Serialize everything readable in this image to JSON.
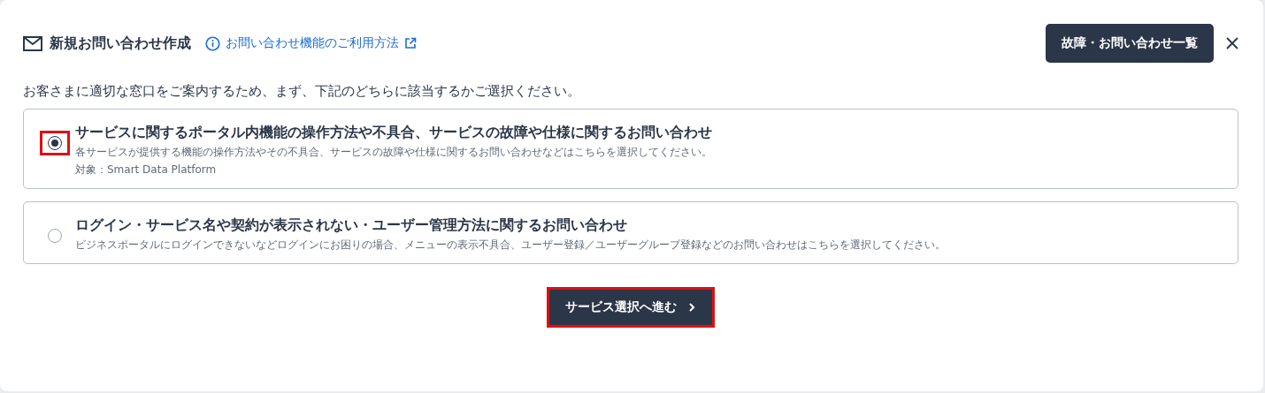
{
  "dialog": {
    "title": "新規お問い合わせ作成",
    "help_link": "お問い合わせ機能のご利用方法",
    "list_button": "故障・お問い合わせ一覧"
  },
  "instruction": "お客さまに適切な窓口をご案内するため、まず、下記のどちらに該当するかご選択ください。",
  "options": [
    {
      "title": "サービスに関するポータル内機能の操作方法や不具合、サービスの故障や仕様に関するお問い合わせ",
      "description": "各サービスが提供する機能の操作方法やその不具合、サービスの故障や仕様に関するお問い合わせなどはこちらを選択してください。",
      "target": "対象：Smart Data Platform",
      "selected": true,
      "highlighted": true
    },
    {
      "title": "ログイン・サービス名や契約が表示されない・ユーザー管理方法に関するお問い合わせ",
      "description": "ビジネスポータルにログインできないなどログインにお困りの場合、メニューの表示不具合、ユーザー登録／ユーザーグループ登録などのお問い合わせはこちらを選択してください。",
      "selected": false,
      "highlighted": false
    }
  ],
  "next_button": {
    "label": "サービス選択へ進む",
    "highlighted": true
  }
}
